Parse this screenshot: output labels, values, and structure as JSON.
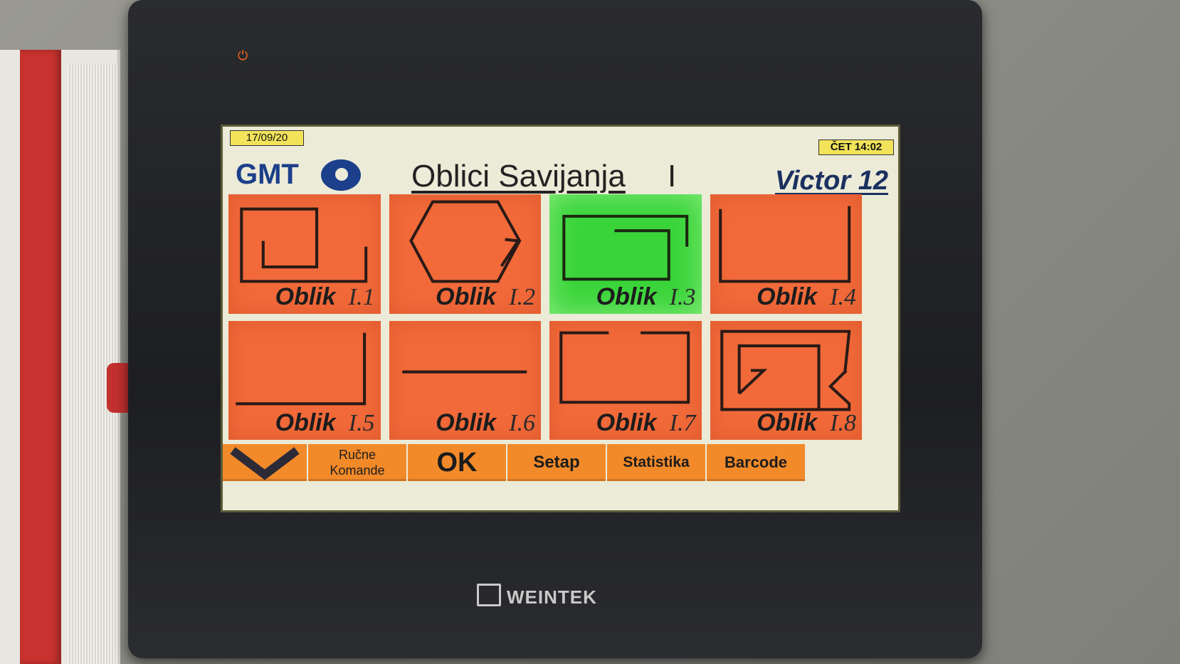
{
  "status": {
    "date": "17/09/20",
    "clock": "ČET 14:02"
  },
  "header": {
    "logo_text": "GMT",
    "title": "Oblici Savijanja",
    "title_suffix": "I",
    "model": "Victor 12"
  },
  "tiles": [
    {
      "word": "Oblik",
      "id": "I.1",
      "selected": false
    },
    {
      "word": "Oblik",
      "id": "I.2",
      "selected": false
    },
    {
      "word": "Oblik",
      "id": "I.3",
      "selected": true
    },
    {
      "word": "Oblik",
      "id": "I.4",
      "selected": false
    },
    {
      "word": "Oblik",
      "id": "I.5",
      "selected": false
    },
    {
      "word": "Oblik",
      "id": "I.6",
      "selected": false
    },
    {
      "word": "Oblik",
      "id": "I.7",
      "selected": false
    },
    {
      "word": "Oblik",
      "id": "I.8",
      "selected": false
    }
  ],
  "bottom_bar": {
    "rucne_line1": "Ručne",
    "rucne_line2": "Komande",
    "ok": "OK",
    "setap": "Setap",
    "statistika": "Statistika",
    "barcode": "Barcode"
  },
  "device": {
    "brand": "WEINTEK"
  },
  "colors": {
    "tile": "#f26a3a",
    "tile_selected": "#3ad43a",
    "button": "#f28a2a",
    "status_yellow": "#f3e35a",
    "logo_blue": "#1b3f8a"
  }
}
